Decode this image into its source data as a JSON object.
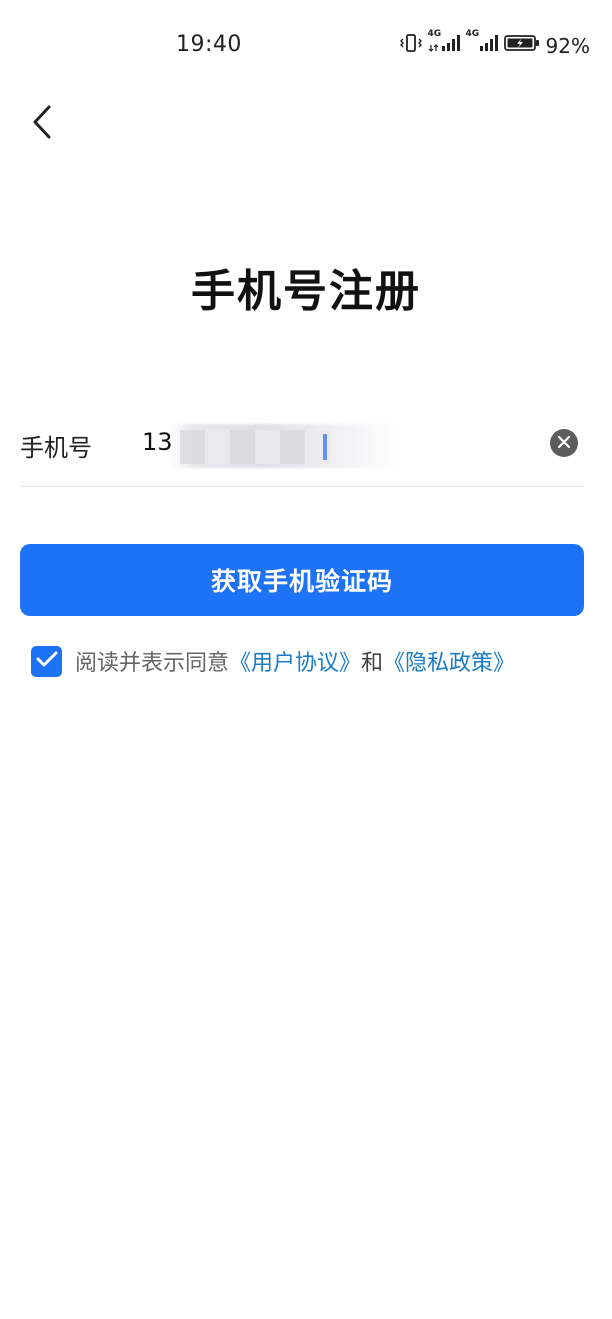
{
  "status_bar": {
    "time": "19:40",
    "network_1": "4G",
    "network_2": "4G",
    "battery": "92%"
  },
  "header": {
    "back_icon": "chevron-left-icon"
  },
  "title": "手机号注册",
  "phone": {
    "label": "手机号",
    "value": "13",
    "clear_icon": "clear-x-icon"
  },
  "get_code_button": "获取手机验证码",
  "agreement": {
    "checked": true,
    "prefix": "阅读并表示同意",
    "user_agreement": "《用户协议》",
    "and": "和",
    "privacy_policy": "《隐私政策》"
  },
  "colors": {
    "accent": "#1e72f5",
    "link": "#1a7cc8"
  }
}
